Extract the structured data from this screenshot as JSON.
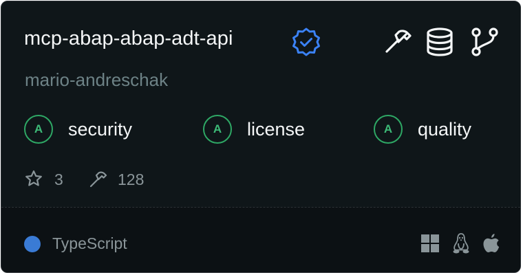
{
  "repo": {
    "name": "mcp-abap-abap-adt-api",
    "owner": "mario-andreschak",
    "verified": true
  },
  "header_icons": [
    "hammer-icon",
    "database-icon",
    "git-branch-icon"
  ],
  "scores": [
    {
      "grade": "A",
      "label": "security"
    },
    {
      "grade": "A",
      "label": "license"
    },
    {
      "grade": "A",
      "label": "quality"
    }
  ],
  "stats": {
    "stars": "3",
    "tools": "128"
  },
  "language": {
    "name": "TypeScript",
    "color": "#3a7bd5"
  },
  "platforms": [
    "windows-icon",
    "linux-icon",
    "apple-icon"
  ],
  "colors": {
    "background": "#0f1619",
    "grade_green": "#2ea865",
    "verified_blue": "#3b82f6"
  }
}
